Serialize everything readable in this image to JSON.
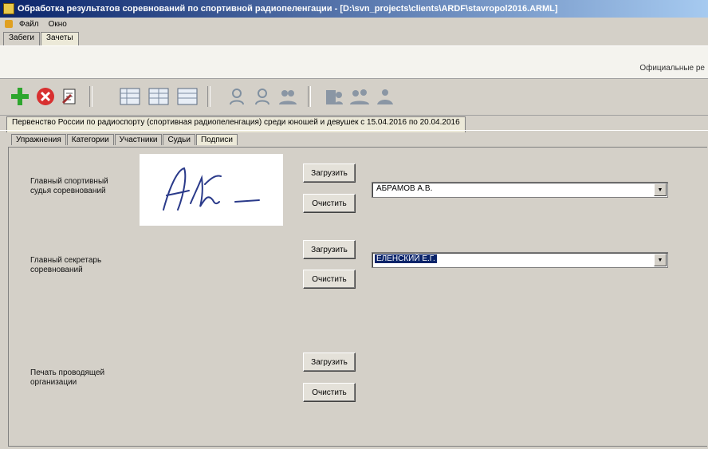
{
  "window": {
    "title": "Обработка результатов соревнований по спортивной радиопеленгации - [D:\\svn_projects\\clients\\ARDF\\stavropol2016.ARML]"
  },
  "menu": {
    "items": [
      "Файл",
      "Окно"
    ]
  },
  "top_tabs": [
    "Забеги",
    "Зачеты"
  ],
  "info": {
    "right_text": "Официальные ре"
  },
  "competition_tab": "Первенство России по радиоспорту (спортивная радиопеленгация) среди юношей и девушек с 15.04.2016 по 20.04.2016",
  "sub_tabs": [
    "Упражнения",
    "Категории",
    "Участники",
    "Судьи",
    "Подписи"
  ],
  "signatures": {
    "chief_judge": {
      "label": "Главный спортивный судья соревнований",
      "value": "АБРАМОВ А.В."
    },
    "chief_secretary": {
      "label": "Главный секретарь соревнований",
      "value": "ЕЛЕНСКИЙ Е.Г."
    },
    "stamp": {
      "label": "Печать проводящей организации"
    }
  },
  "buttons": {
    "upload": "Загрузить",
    "clear": "Очистить"
  },
  "signature_text": "Абм –"
}
